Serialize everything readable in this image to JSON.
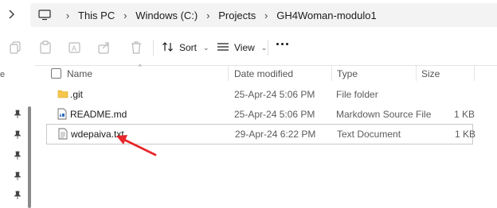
{
  "window": {
    "breadcrumbs": [
      "This PC",
      "Windows (C:)",
      "Projects",
      "GH4Woman-modulo1"
    ]
  },
  "toolbar": {
    "sort_label": "Sort",
    "view_label": "View",
    "icons": [
      "copy-icon",
      "paste-icon",
      "rename-icon",
      "share-icon",
      "delete-icon",
      "sort-icon",
      "view-icon",
      "more-icon"
    ]
  },
  "nav": {
    "partial_label": "e"
  },
  "list": {
    "columns": [
      "Name",
      "Date modified",
      "Type",
      "Size"
    ],
    "rows": [
      {
        "name": ".git",
        "date": "25-Apr-24 5:06 PM",
        "type": "File folder",
        "size": "",
        "icon": "folder-icon"
      },
      {
        "name": "README.md",
        "date": "25-Apr-24 5:06 PM",
        "type": "Markdown Source File",
        "size": "1 KB",
        "icon": "markdown-file-icon"
      },
      {
        "name": "wdepaiva.txt",
        "date": "29-Apr-24 6:22 PM",
        "type": "Text Document",
        "size": "1 KB",
        "icon": "text-file-icon",
        "selected": true
      }
    ]
  },
  "annotation": {
    "color": "#e8262b",
    "type": "red-arrow"
  }
}
